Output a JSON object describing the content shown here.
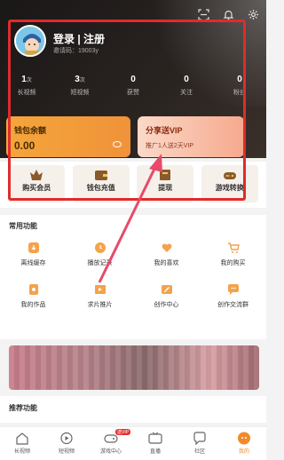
{
  "header": {
    "icons": [
      "scan-icon",
      "bell-icon",
      "settings-icon"
    ]
  },
  "profile": {
    "login_label": "登录 | 注册",
    "invite_code": "邀请码：19003y"
  },
  "stats": [
    {
      "num": "1",
      "unit": "次",
      "label": "长视频"
    },
    {
      "num": "3",
      "unit": "次",
      "label": "短视频"
    },
    {
      "num": "0",
      "unit": "",
      "label": "获赞"
    },
    {
      "num": "0",
      "unit": "",
      "label": "关注"
    },
    {
      "num": "0",
      "unit": "",
      "label": "粉丝"
    }
  ],
  "wallet": {
    "title": "钱包余额",
    "value": "0.00"
  },
  "share": {
    "title": "分享送VIP",
    "subtitle": "推广1人送2天VIP"
  },
  "quick_actions": [
    {
      "label": "购买会员",
      "icon": "crown-icon"
    },
    {
      "label": "钱包充值",
      "icon": "wallet-icon"
    },
    {
      "label": "提现",
      "icon": "cash-icon"
    },
    {
      "label": "游戏转换",
      "icon": "gamepad-icon"
    }
  ],
  "common": {
    "title": "常用功能",
    "items": [
      {
        "label": "离线缓存",
        "icon": "download-icon"
      },
      {
        "label": "播放记录",
        "icon": "history-icon"
      },
      {
        "label": "我的喜欢",
        "icon": "heart-icon"
      },
      {
        "label": "我的购买",
        "icon": "cart-icon"
      },
      {
        "label": "我的作品",
        "icon": "works-icon"
      },
      {
        "label": "求片推片",
        "icon": "film-icon"
      },
      {
        "label": "创作中心",
        "icon": "create-icon"
      },
      {
        "label": "创作交流群",
        "icon": "chat-icon"
      }
    ]
  },
  "recommend": {
    "title": "推荐功能"
  },
  "tabbar": [
    {
      "label": "长视频",
      "icon": "home-icon",
      "active": false
    },
    {
      "label": "短视频",
      "icon": "play-icon",
      "active": false
    },
    {
      "label": "游戏中心",
      "icon": "game-icon",
      "active": false,
      "badge": "送VIP"
    },
    {
      "label": "直播",
      "icon": "live-icon",
      "active": false
    },
    {
      "label": "社区",
      "icon": "community-icon",
      "active": false
    },
    {
      "label": "我的",
      "icon": "profile-icon",
      "active": true
    }
  ],
  "colors": {
    "accent": "#f08a2a",
    "highlight_border": "#e02b2b"
  }
}
